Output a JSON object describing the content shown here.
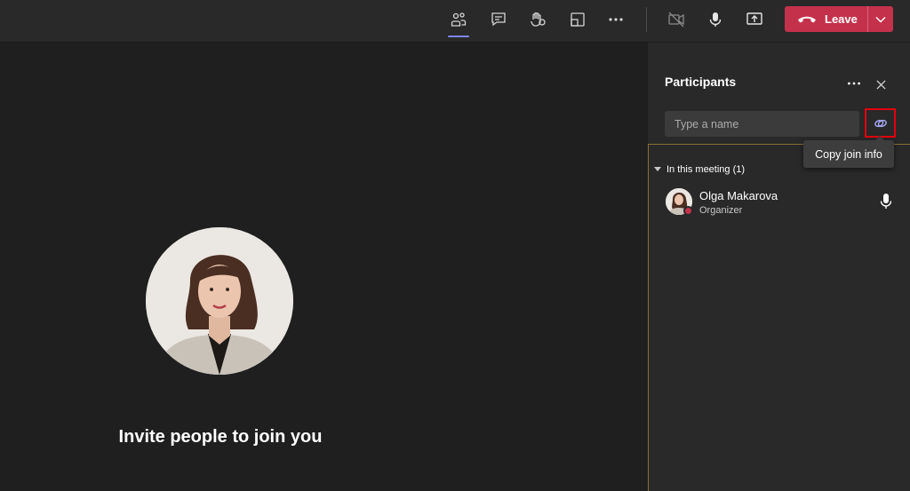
{
  "toolbar": {
    "buttons": [
      {
        "name": "participants-icon",
        "active": true
      },
      {
        "name": "chat-icon"
      },
      {
        "name": "raise-hand-icon"
      },
      {
        "name": "rooms-icon"
      },
      {
        "name": "more-icon"
      },
      {
        "name": "camera-off-icon"
      },
      {
        "name": "microphone-icon"
      },
      {
        "name": "share-icon"
      }
    ],
    "leave_label": "Leave"
  },
  "stage": {
    "invite_text": "Invite people to join you"
  },
  "panel": {
    "title": "Participants",
    "search_placeholder": "Type a name",
    "tooltip": "Copy join info",
    "section_label": "In this meeting (1)",
    "participants": [
      {
        "name": "Olga Makarova",
        "role": "Organizer",
        "status_color": "#c4314b"
      }
    ]
  },
  "colors": {
    "accent": "#7f85f5",
    "leave": "#c4314b",
    "highlight": "#e3000f"
  }
}
